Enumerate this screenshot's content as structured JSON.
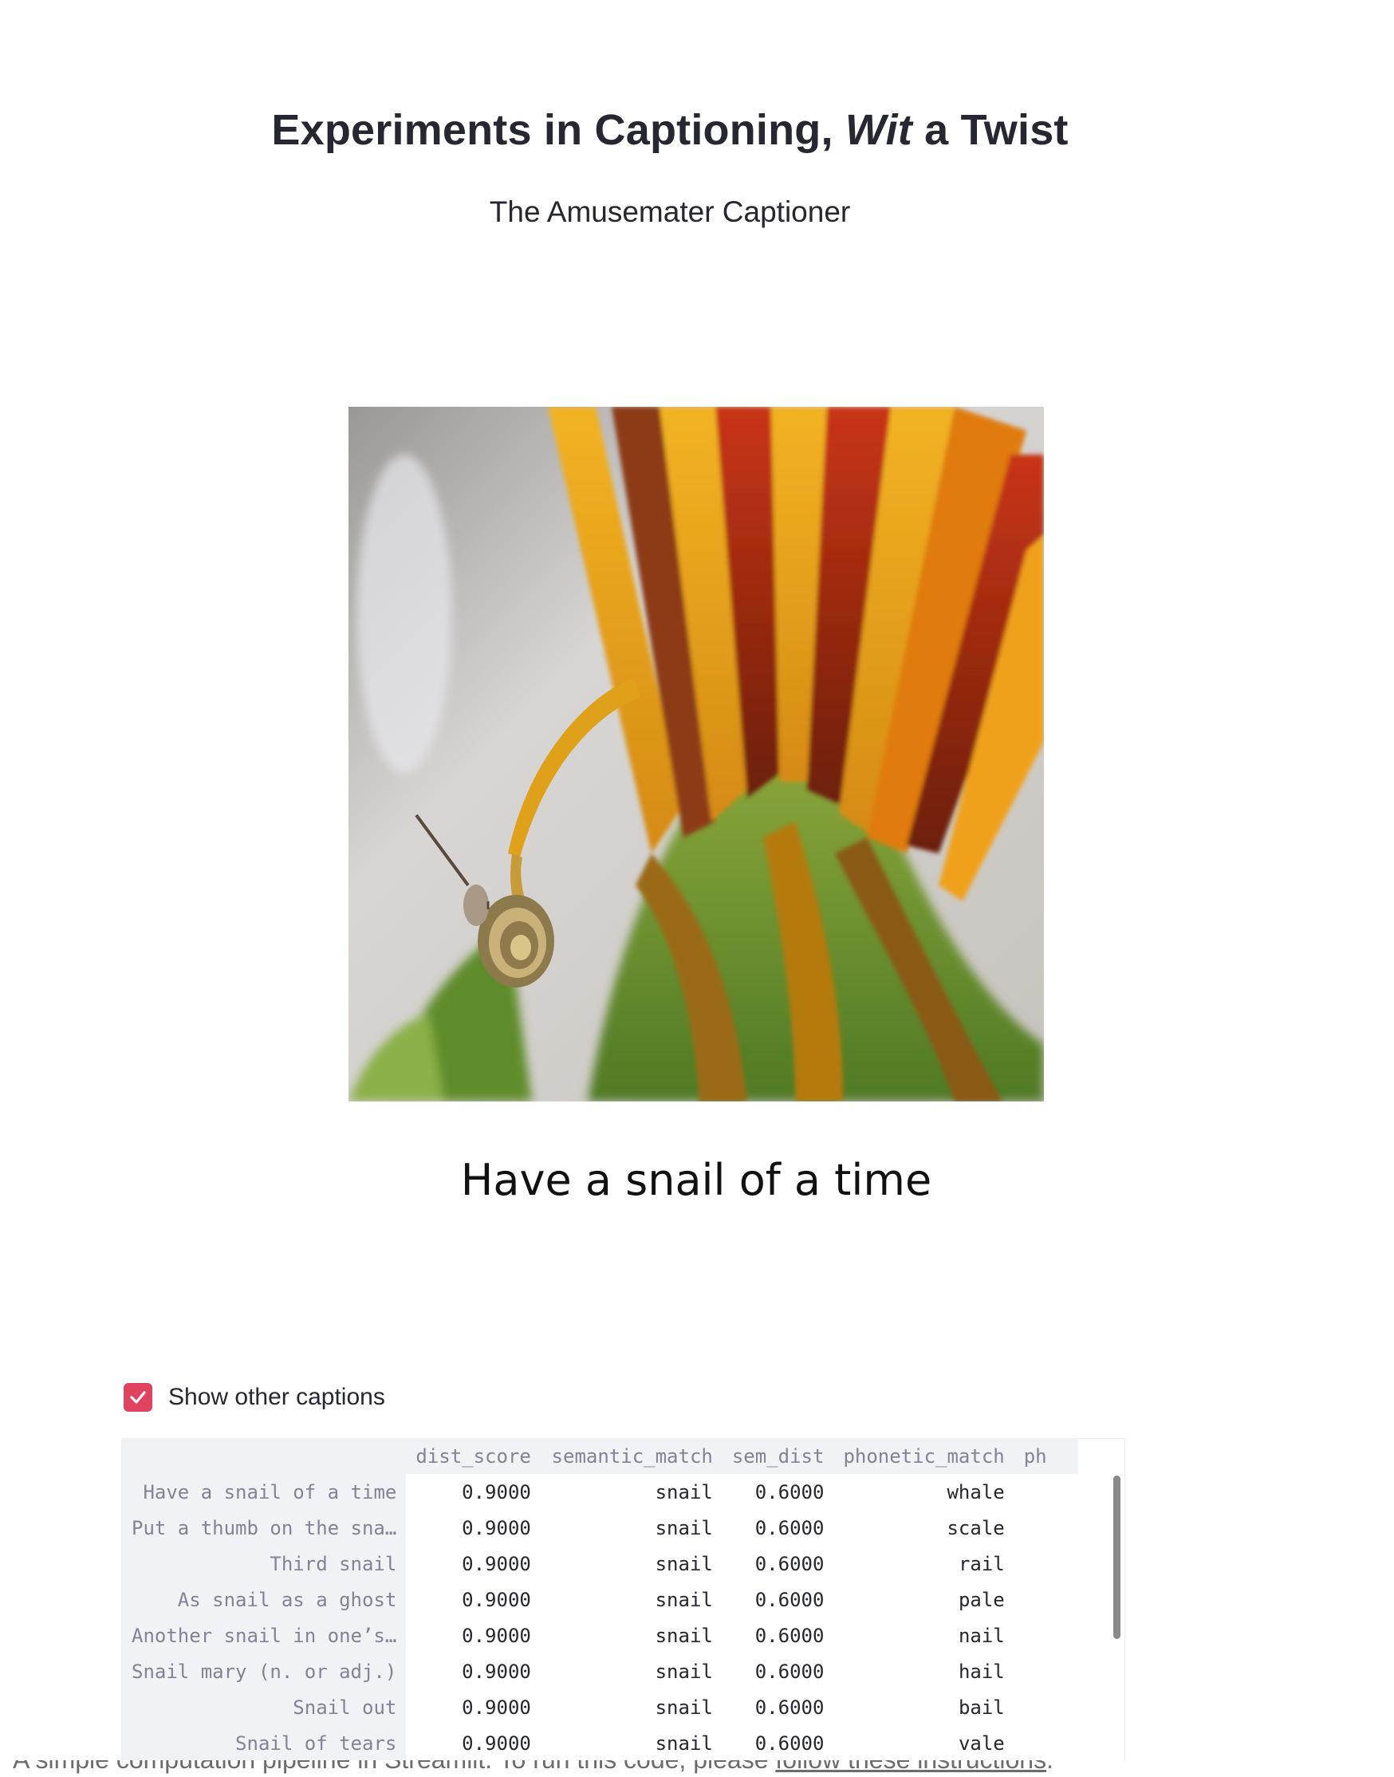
{
  "header": {
    "title_part1": "Experiments in Captioning, ",
    "title_italic": "Wit",
    "title_part2": " a Twist",
    "subtitle": "The Amusemater Captioner"
  },
  "image": {
    "description": "snail-on-flower-photo"
  },
  "caption": {
    "text": "Have a snail of a time"
  },
  "options": {
    "show_other_captions_label": "Show other captions",
    "show_other_captions_checked": true,
    "accent_color": "#e0435f"
  },
  "table": {
    "columns": [
      "dist_score",
      "semantic_match",
      "sem_dist",
      "phonetic_match",
      "ph"
    ],
    "rows": [
      {
        "index": "Have a snail of a time",
        "dist_score": "0.9000",
        "semantic_match": "snail",
        "sem_dist": "0.6000",
        "phonetic_match": "whale"
      },
      {
        "index": "Put a thumb on the sna…",
        "dist_score": "0.9000",
        "semantic_match": "snail",
        "sem_dist": "0.6000",
        "phonetic_match": "scale"
      },
      {
        "index": "Third snail",
        "dist_score": "0.9000",
        "semantic_match": "snail",
        "sem_dist": "0.6000",
        "phonetic_match": "rail"
      },
      {
        "index": "As snail as a ghost",
        "dist_score": "0.9000",
        "semantic_match": "snail",
        "sem_dist": "0.6000",
        "phonetic_match": "pale"
      },
      {
        "index": "Another snail in one’s…",
        "dist_score": "0.9000",
        "semantic_match": "snail",
        "sem_dist": "0.6000",
        "phonetic_match": "nail"
      },
      {
        "index": "Snail mary (n. or adj.)",
        "dist_score": "0.9000",
        "semantic_match": "snail",
        "sem_dist": "0.6000",
        "phonetic_match": "hail"
      },
      {
        "index": "Snail out",
        "dist_score": "0.9000",
        "semantic_match": "snail",
        "sem_dist": "0.6000",
        "phonetic_match": "bail"
      },
      {
        "index": "Snail of tears",
        "dist_score": "0.9000",
        "semantic_match": "snail",
        "sem_dist": "0.6000",
        "phonetic_match": "vale"
      }
    ]
  },
  "footer": {
    "text": "A simple computation pipeline in Streamlit. To run this code, please ",
    "link_label": "follow these instructions",
    "suffix": "."
  }
}
